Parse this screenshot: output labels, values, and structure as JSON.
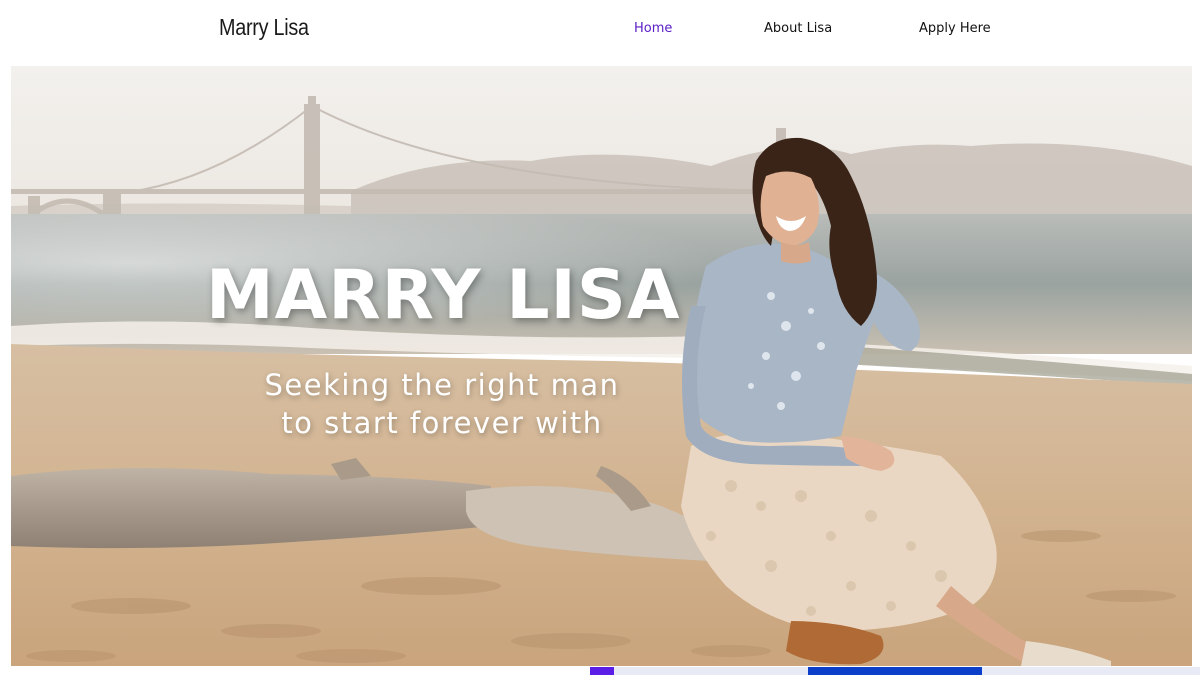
{
  "header": {
    "logo": "Marry Lisa",
    "nav": [
      {
        "label": "Home",
        "active": true
      },
      {
        "label": "About Lisa",
        "active": false
      },
      {
        "label": "Apply Here",
        "active": false
      }
    ]
  },
  "hero": {
    "title": "MARRY LISA",
    "subtitle_lines": [
      "Seeking the right man",
      "to start forever with"
    ]
  },
  "colors": {
    "active_nav": "#5b1ec7",
    "bar_accent": "#5b1ee6",
    "bar_blue": "#0b3fc9"
  }
}
